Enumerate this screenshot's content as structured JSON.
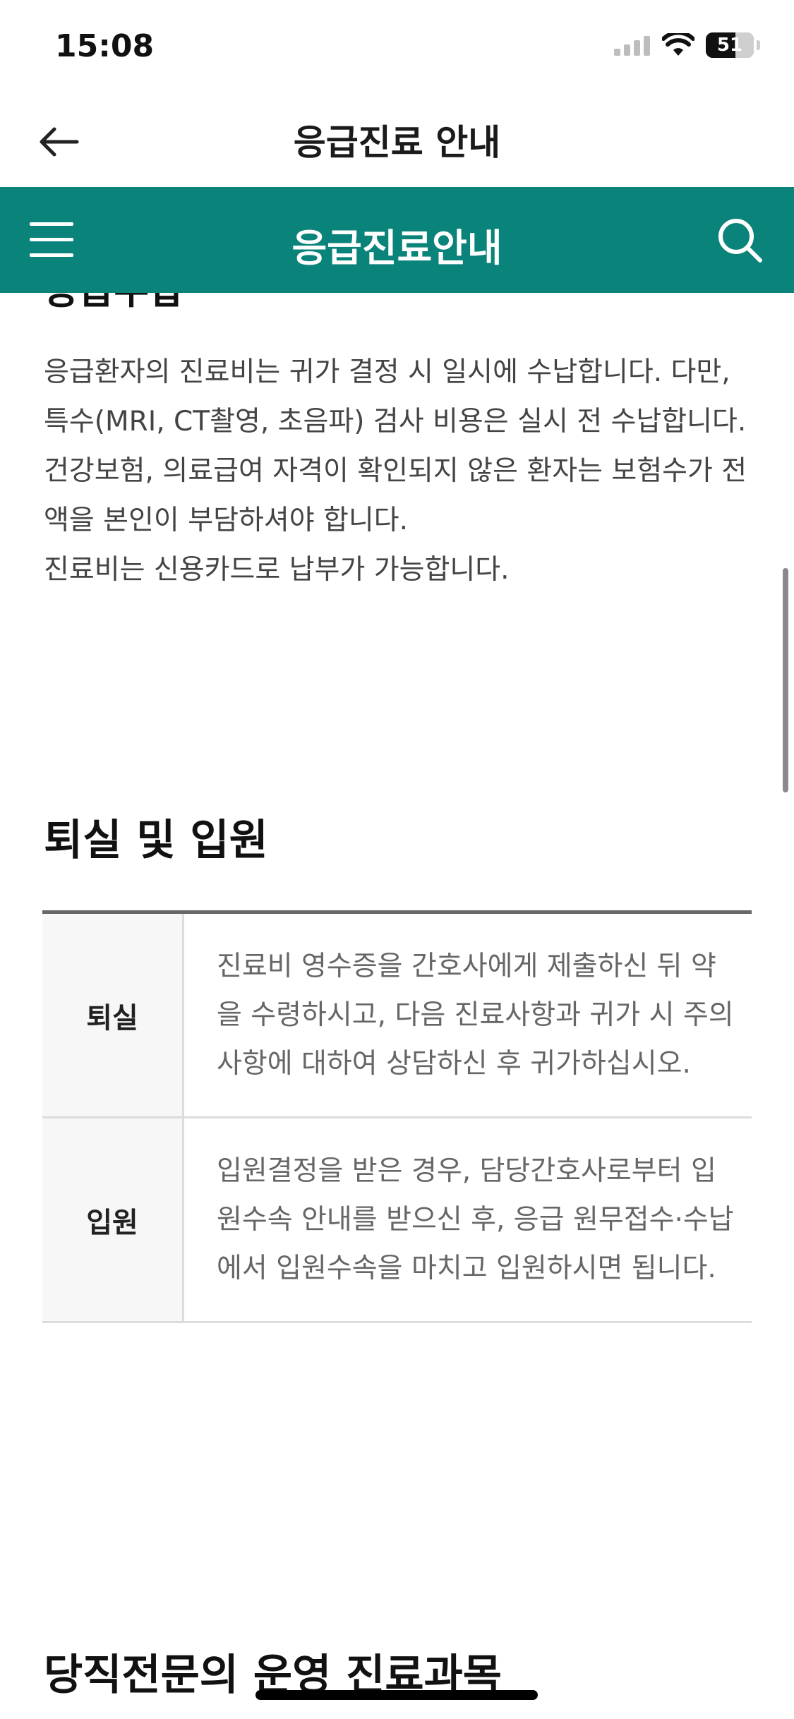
{
  "status_bar": {
    "time": "15:08",
    "battery": "51"
  },
  "nav": {
    "title": "응급진료 안내"
  },
  "header": {
    "title": "응급진료안내"
  },
  "payment": {
    "cut_heading": "응급수납",
    "paragraphs": [
      "응급환자의 진료비는 귀가 결정 시 일시에 수납합니다. 다만, 특수(MRI, CT촬영, 초음파) 검사 비용은 실시 전 수납합니다.",
      "건강보험, 의료급여 자격이 확인되지 않은 환자는 보험수가 전액을 본인이 부담하셔야 합니다.",
      "진료비는 신용카드로 납부가 가능합니다."
    ]
  },
  "discharge_section": {
    "title": "퇴실 및 입원",
    "rows": [
      {
        "label": "퇴실",
        "text": "진료비 영수증을 간호사에게 제출하신 뒤 약을 수령하시고, 다음 진료사항과 귀가 시 주의사항에 대하여 상담하신 후 귀가하십시오."
      },
      {
        "label": "입원",
        "text": "입원결정을 받은 경우, 담당간호사로부터 입원수속 안내를 받으신 후, 응급 원무접수·수납에서 입원수속을 마치고 입원하시면 됩니다."
      }
    ]
  },
  "next_section": {
    "title": "당직전문의 운영 진료과목"
  },
  "colors": {
    "header_bg": "#0a837a"
  },
  "icons": {
    "back": "arrow-left-icon",
    "menu": "hamburger-menu-icon",
    "search": "search-icon"
  }
}
